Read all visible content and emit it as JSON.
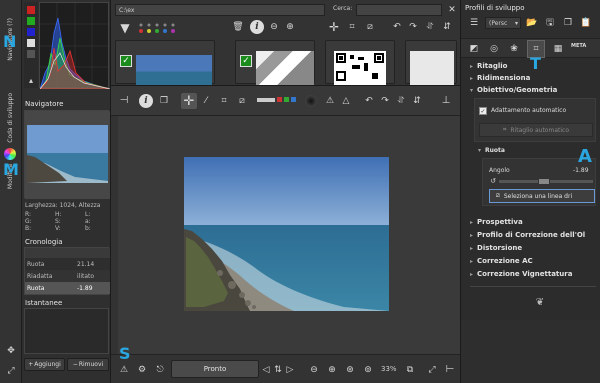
{
  "left_tabs": {
    "navigator_tab": "Navigatore (?)",
    "queue_tab": "Coda di sviluppo",
    "editor_tab": "Modifica"
  },
  "left_panel": {
    "navigator_title": "Navigatore",
    "size_text": "Larghezza: 1024, Altezza",
    "rgb": [
      {
        "k": "R:",
        "v": "—",
        "k2": "H:",
        "v2": "—",
        "k3": "L:",
        "v3": "—"
      },
      {
        "k": "G:",
        "v": "—",
        "k2": "S:",
        "v2": "—",
        "k3": "a:",
        "v3": "—"
      },
      {
        "k": "B:",
        "v": "—",
        "k2": "V:",
        "v2": "—",
        "k3": "b:",
        "v3": "—"
      }
    ],
    "history_title": "Cronologia",
    "history": [
      {
        "name": "Ruota",
        "value": "21.14"
      },
      {
        "name": "Riadatta",
        "value": "ilitato"
      },
      {
        "name": "Ruota",
        "value": "-1.89"
      }
    ],
    "snapshots_title": "Istantanee",
    "add_label": "Aggiungi",
    "remove_label": "Rimuovi"
  },
  "browser": {
    "path": "C:\\ex",
    "search_label": "Cerca:"
  },
  "bottom_bar": {
    "status": "Pronto",
    "zoom": "33%"
  },
  "right_panel": {
    "profiles_title": "Profili di sviluppo",
    "profile_value": "(Persc",
    "sections": [
      {
        "arrow": "▸",
        "label": "Ritaglio"
      },
      {
        "arrow": "▸",
        "label": "Ridimensiona"
      },
      {
        "arrow": "▾",
        "label": "Obiettivo/Geometria"
      }
    ],
    "auto_fill": "Adattamento automatico",
    "auto_crop": "Ritaglio automatico",
    "rotate_title": "Ruota",
    "angle_label": "Angolo",
    "angle_value": "-1.89",
    "angle_fraction": 0.48,
    "select_line": "Seleziona una linea dri",
    "more_sections": [
      {
        "arrow": "▸",
        "label": "Prospettiva"
      },
      {
        "arrow": "▸",
        "label": "Profilo di Correzione dell'Ol"
      },
      {
        "arrow": "▸",
        "label": "Distorsione"
      },
      {
        "arrow": "▸",
        "label": "Correzione AC"
      },
      {
        "arrow": "▸",
        "label": "Correzione Vignettatura"
      }
    ]
  },
  "annotations": {
    "n": "N",
    "m": "M",
    "t": "T",
    "a": "A",
    "s": "S"
  },
  "colors": {
    "accent": "#2aa7e0",
    "panel": "#2e2e2e",
    "sky": "#4a78b8",
    "sea": "#2f6f93"
  }
}
